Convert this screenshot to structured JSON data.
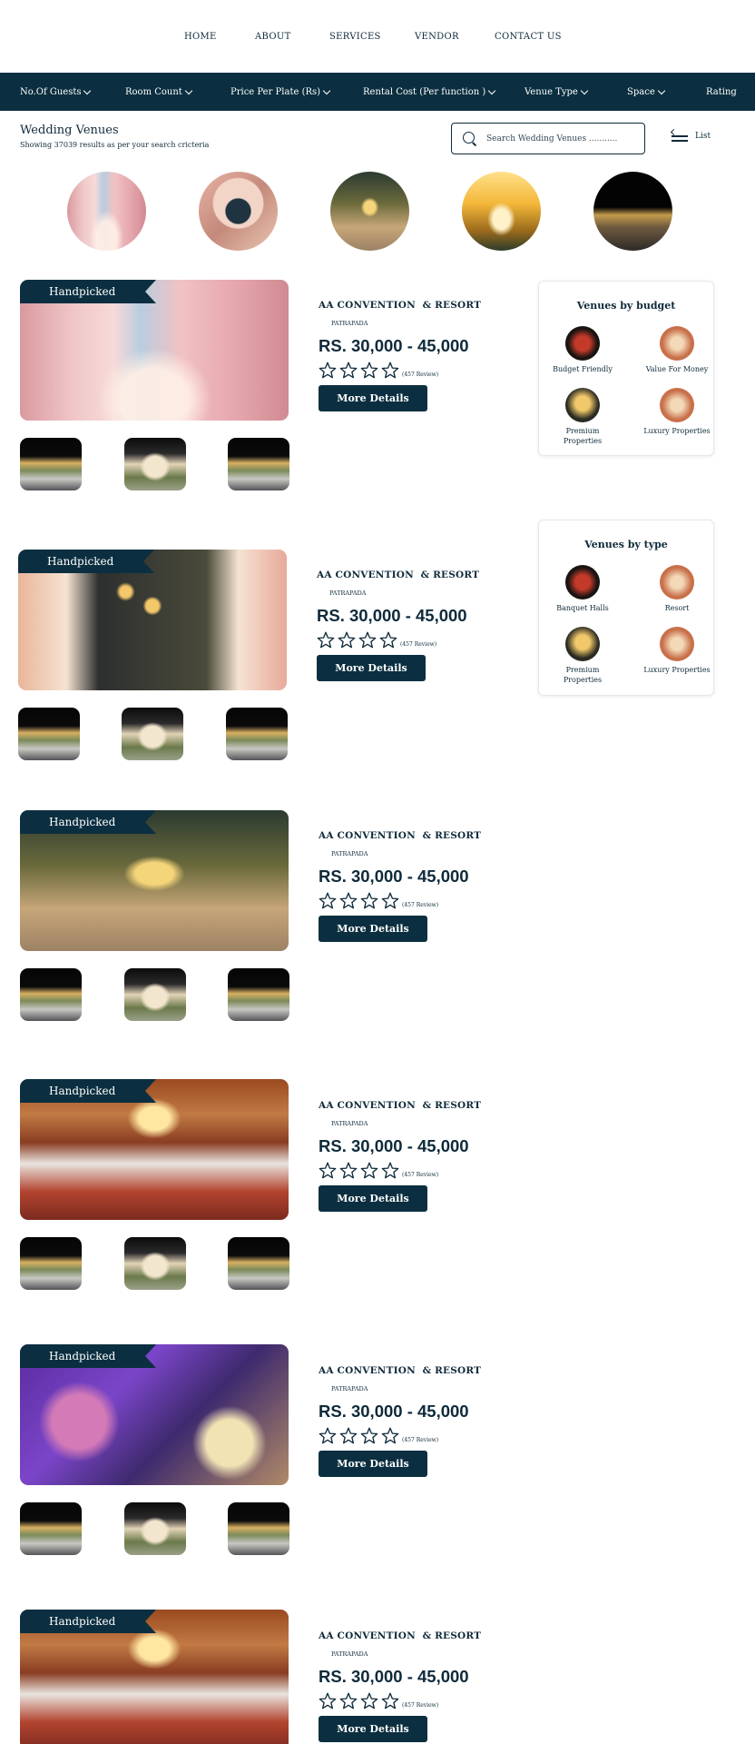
{
  "nav": {
    "items": [
      "HOME",
      "ABOUT",
      "SERVICES",
      "VENDOR",
      "CONTACT US"
    ]
  },
  "filters": [
    "No.Of Guests",
    "Room Count",
    "Price Per Plate (Rs)",
    "Rental Cost (Per function )",
    "Venue Type",
    "Space",
    "Rating"
  ],
  "page": {
    "title": "Wedding Venues",
    "subtitle": "Showing 37039 results as per your search cricteria"
  },
  "search": {
    "placeholder": "Search Wedding Venues ..........."
  },
  "view_toggle": {
    "label": "List"
  },
  "listing_common": {
    "badge": "Handpicked",
    "name": "AA CONVENTION  & RESORT",
    "location": "PATRAPADA",
    "price": "RS. 30,000 - 45,000",
    "reviews": "(457 Review)",
    "button": "More Details"
  },
  "budget_card": {
    "title": "Venues by budget",
    "items": [
      "Budget Friendly",
      "Value For Money",
      "Premium\nProperties",
      "Luxury Properties"
    ]
  },
  "type_card": {
    "title": "Venues by type",
    "items": [
      "Banquet Halls",
      "Resort",
      "Premium\nProperties",
      "Luxury Properties"
    ]
  },
  "colors": {
    "primary": "#0b2f40",
    "text": "#0f2a3a",
    "background": "#ffffff"
  }
}
